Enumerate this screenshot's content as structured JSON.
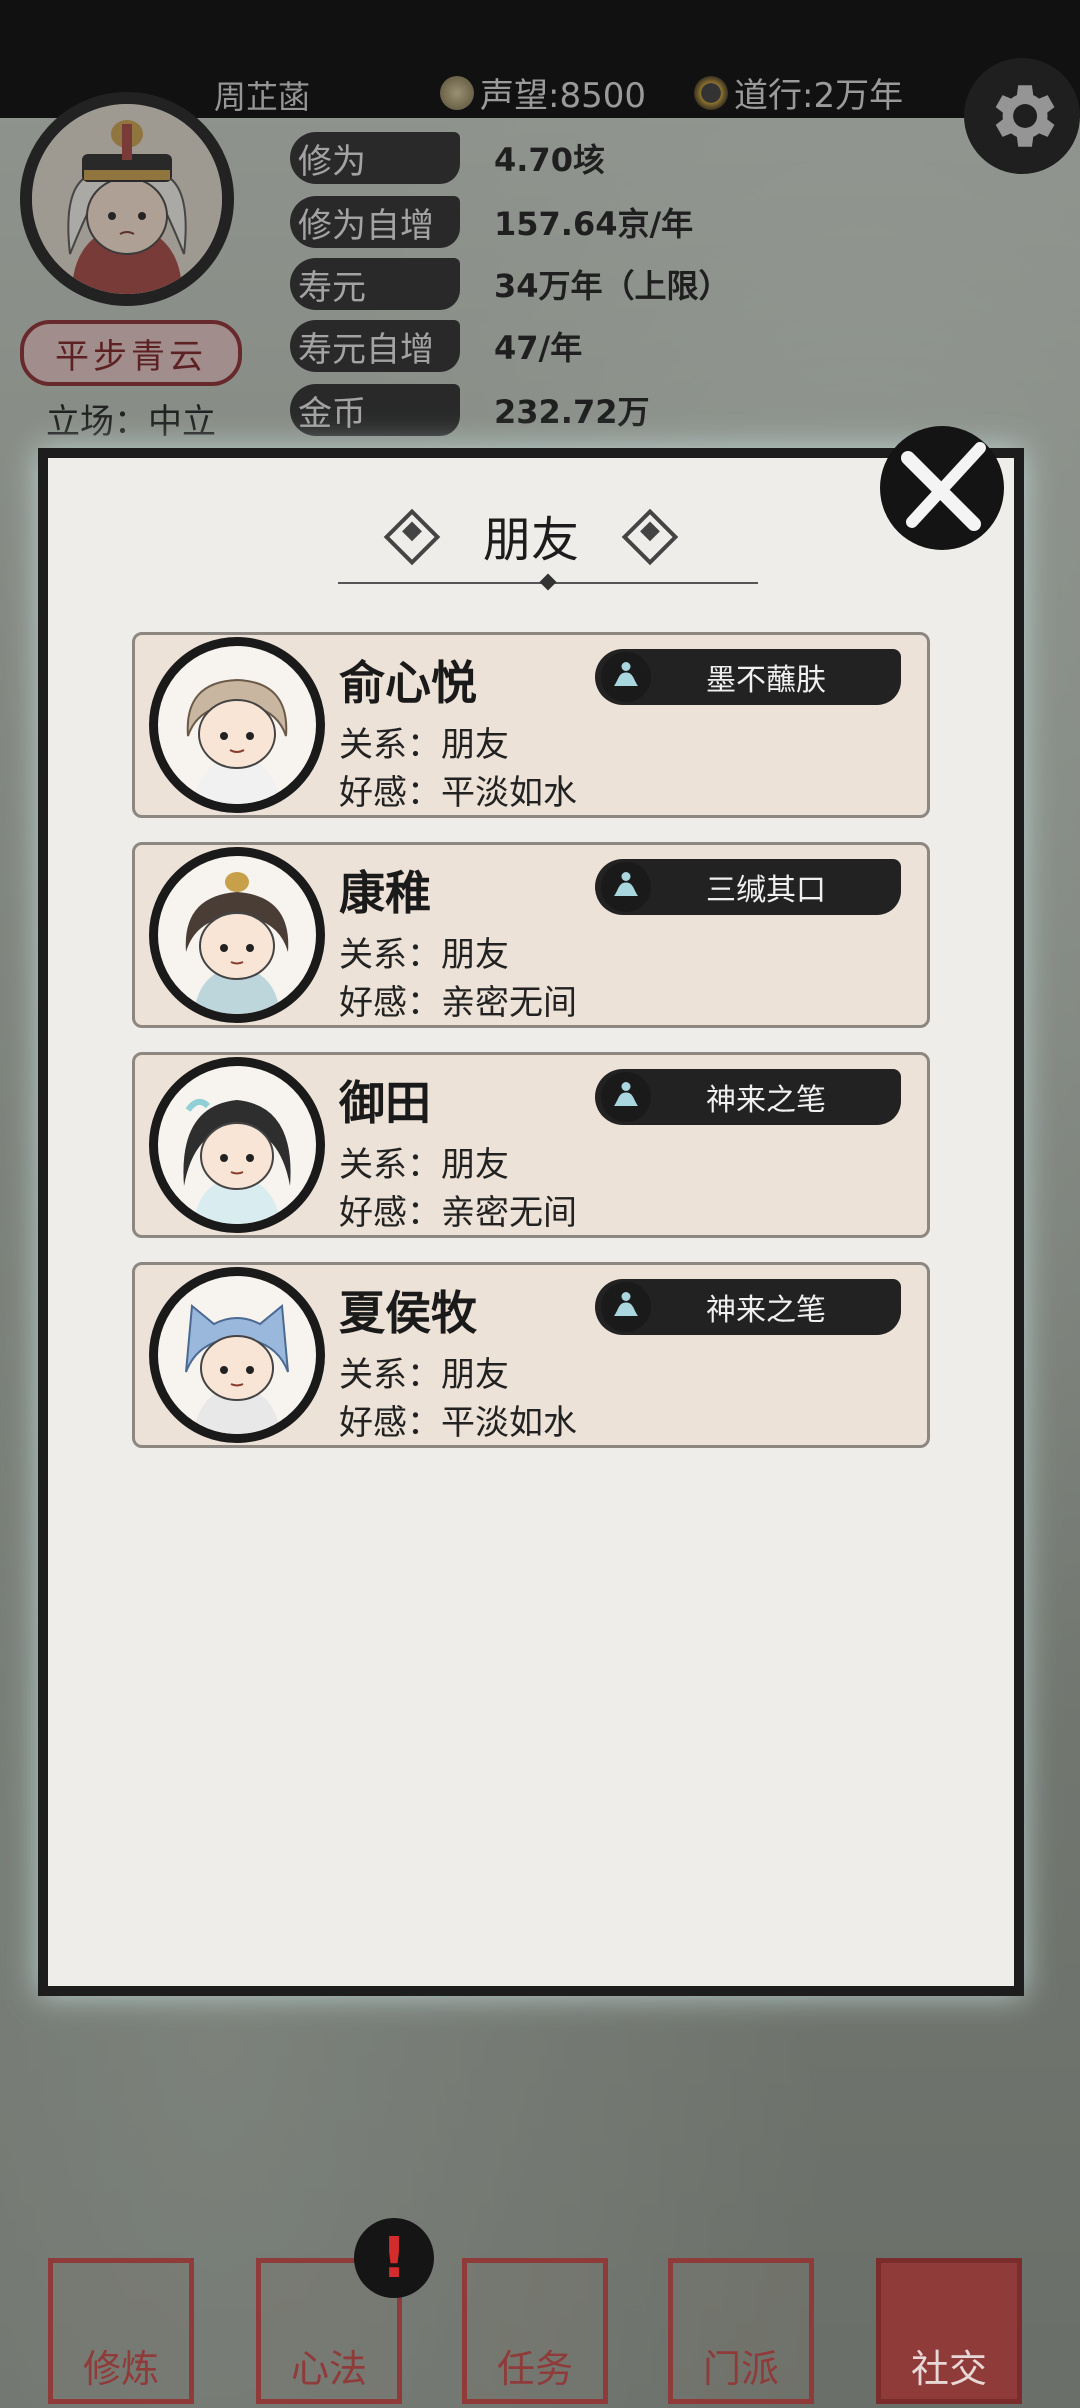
{
  "player": {
    "name": "周芷菡",
    "prestige": "声望:8500",
    "dao_practice": "道行:2万年",
    "title_badge": "平步青云",
    "stance": "立场：中立"
  },
  "stats": [
    {
      "label": "修为",
      "value": "4.70垓"
    },
    {
      "label": "修为自增",
      "value": "157.64京/年"
    },
    {
      "label": "寿元",
      "value": "34万年（上限）"
    },
    {
      "label": "寿元自增",
      "value": "47/年"
    },
    {
      "label": "金币",
      "value": "232.72万"
    }
  ],
  "panel": {
    "title": "朋友"
  },
  "friends": [
    {
      "name": "俞心悦",
      "relation": "关系：朋友",
      "affinity": "好感：平淡如水",
      "skill": "墨不蘸肤"
    },
    {
      "name": "康稚",
      "relation": "关系：朋友",
      "affinity": "好感：亲密无间",
      "skill": "三缄其口"
    },
    {
      "name": "御田",
      "relation": "关系：朋友",
      "affinity": "好感：亲密无间",
      "skill": "神来之笔"
    },
    {
      "name": "夏侯牧",
      "relation": "关系：朋友",
      "affinity": "好感：平淡如水",
      "skill": "神来之笔"
    }
  ],
  "nav": [
    {
      "label": "修炼",
      "active": false
    },
    {
      "label": "心法",
      "active": false
    },
    {
      "label": "任务",
      "active": false
    },
    {
      "label": "门派",
      "active": false
    },
    {
      "label": "社交",
      "active": true
    }
  ],
  "alert_mark": "!"
}
